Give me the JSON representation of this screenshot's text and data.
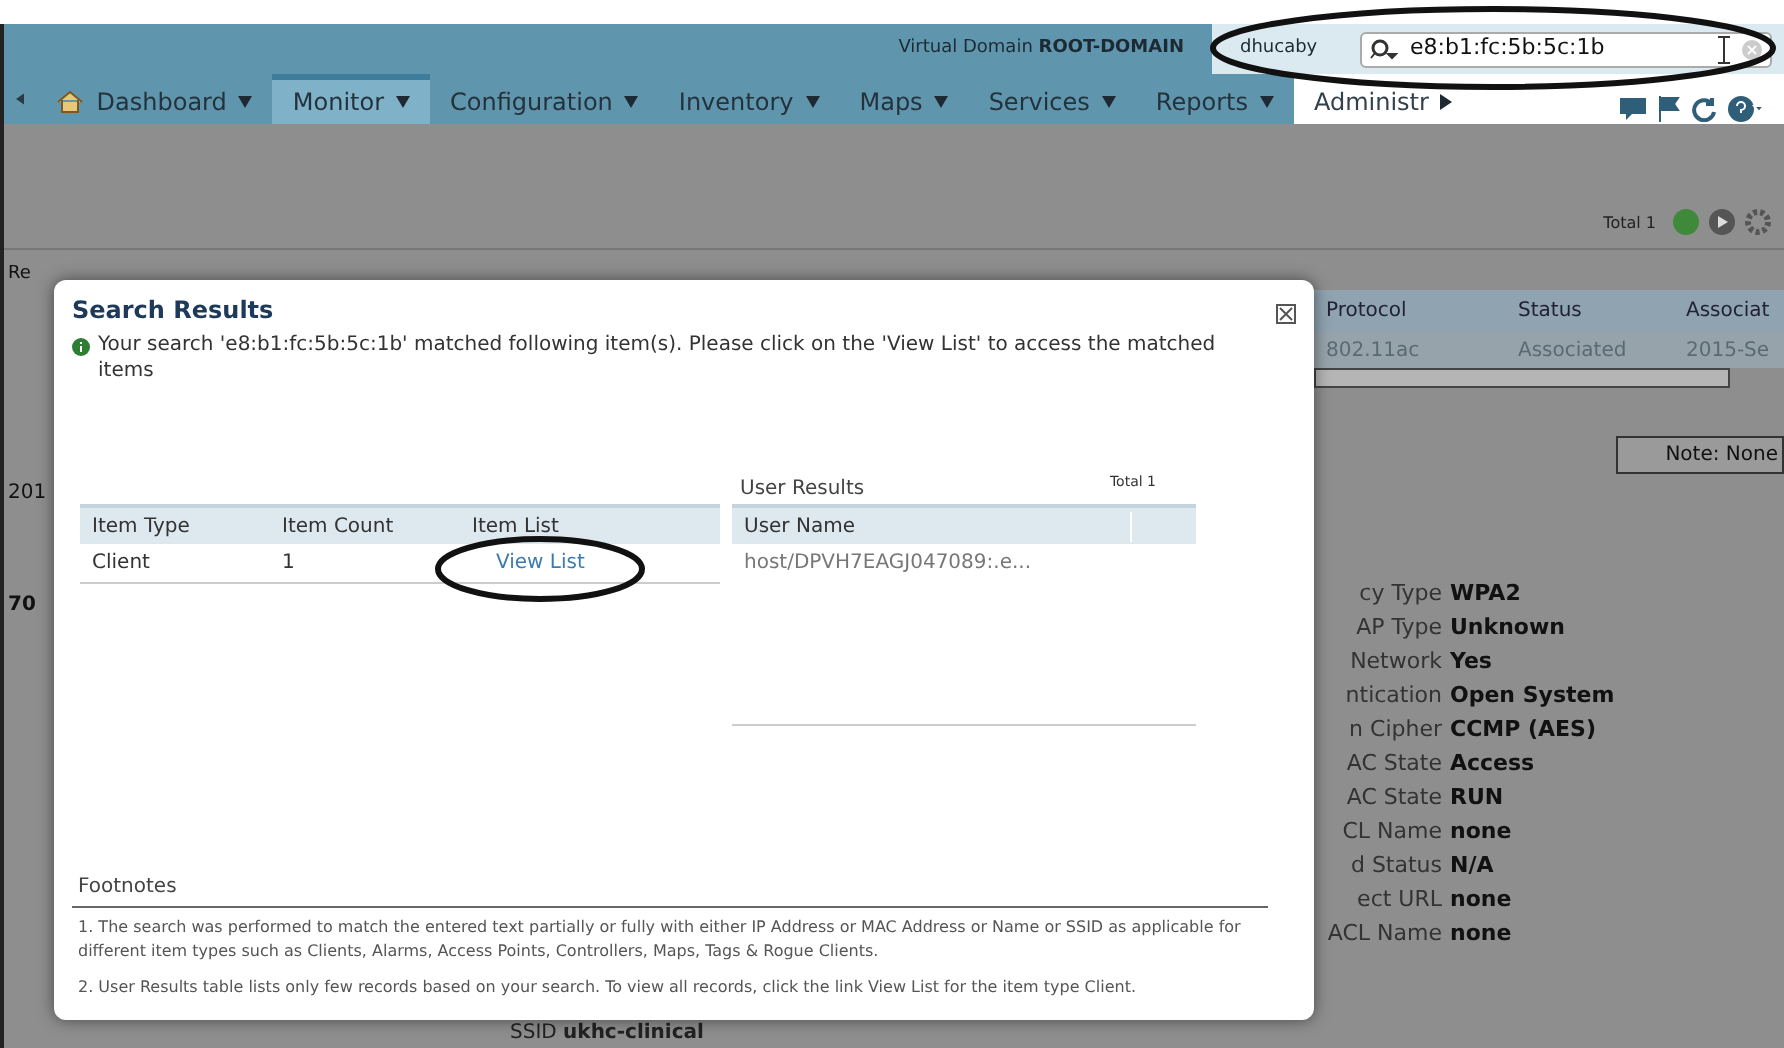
{
  "header": {
    "domain_label": "Virtual Domain",
    "domain_value": "ROOT-DOMAIN",
    "user": "dhucaby",
    "search": {
      "value": "e8:b1:fc:5b:5c:1b"
    }
  },
  "nav": [
    {
      "label": "Dashboard",
      "kind": "home",
      "selected": false
    },
    {
      "label": "Monitor",
      "kind": "menu",
      "selected": true
    },
    {
      "label": "Configuration",
      "kind": "menu",
      "selected": false
    },
    {
      "label": "Inventory",
      "kind": "menu",
      "selected": false
    },
    {
      "label": "Maps",
      "kind": "menu",
      "selected": false
    },
    {
      "label": "Services",
      "kind": "menu",
      "selected": false
    },
    {
      "label": "Reports",
      "kind": "menu",
      "selected": false
    },
    {
      "label": "Administr",
      "kind": "more",
      "selected": false
    }
  ],
  "toolbar": {
    "total": "Total 1"
  },
  "background": {
    "left_fragments": [
      "Re",
      "201",
      "70"
    ],
    "columns": [
      "Protocol",
      "Status",
      "Associat"
    ],
    "row": [
      "802.11ac",
      "Associated",
      "2015-Se"
    ],
    "note": "Note: None",
    "details": [
      {
        "label": "cy Type",
        "value": "WPA2"
      },
      {
        "label": "AP Type",
        "value": "Unknown"
      },
      {
        "label": "Network",
        "value": "Yes"
      },
      {
        "label": "ntication",
        "value": "Open System"
      },
      {
        "label": "n Cipher",
        "value": "CCMP (AES)"
      },
      {
        "label": "AC State",
        "value": "Access"
      },
      {
        "label": "AC State",
        "value": "RUN"
      },
      {
        "label": "CL Name",
        "value": "none"
      },
      {
        "label": "d Status",
        "value": "N/A"
      },
      {
        "label": "ect URL",
        "value": "none"
      },
      {
        "label": "ACL Name",
        "value": "none"
      }
    ],
    "ssid": {
      "label": "SSID",
      "value": "ukhc-clinical"
    }
  },
  "dialog": {
    "title": "Search Results",
    "message": "Your search 'e8:b1:fc:5b:5c:1b' matched following item(s). Please click on the 'View List' to access the matched items",
    "items_table": {
      "columns": [
        "Item Type",
        "Item Count",
        "Item List"
      ],
      "rows": [
        [
          "Client",
          "1",
          "View List"
        ]
      ]
    },
    "user_results": {
      "title": "User Results",
      "total": "Total 1",
      "columns": [
        "User Name"
      ],
      "rows": [
        "host/DPVH7EAGJ047089:.e..."
      ]
    },
    "footnotes_title": "Footnotes",
    "footnotes": [
      "1. The search was performed to match the entered text partially or fully with either IP Address or MAC Address or Name or SSID as applicable for different item types such as Clients, Alarms, Access Points, Controllers, Maps, Tags & Rogue Clients.",
      "2. User Results table lists only few records based on your search. To view all records, click the link View List for the item type Client."
    ]
  }
}
